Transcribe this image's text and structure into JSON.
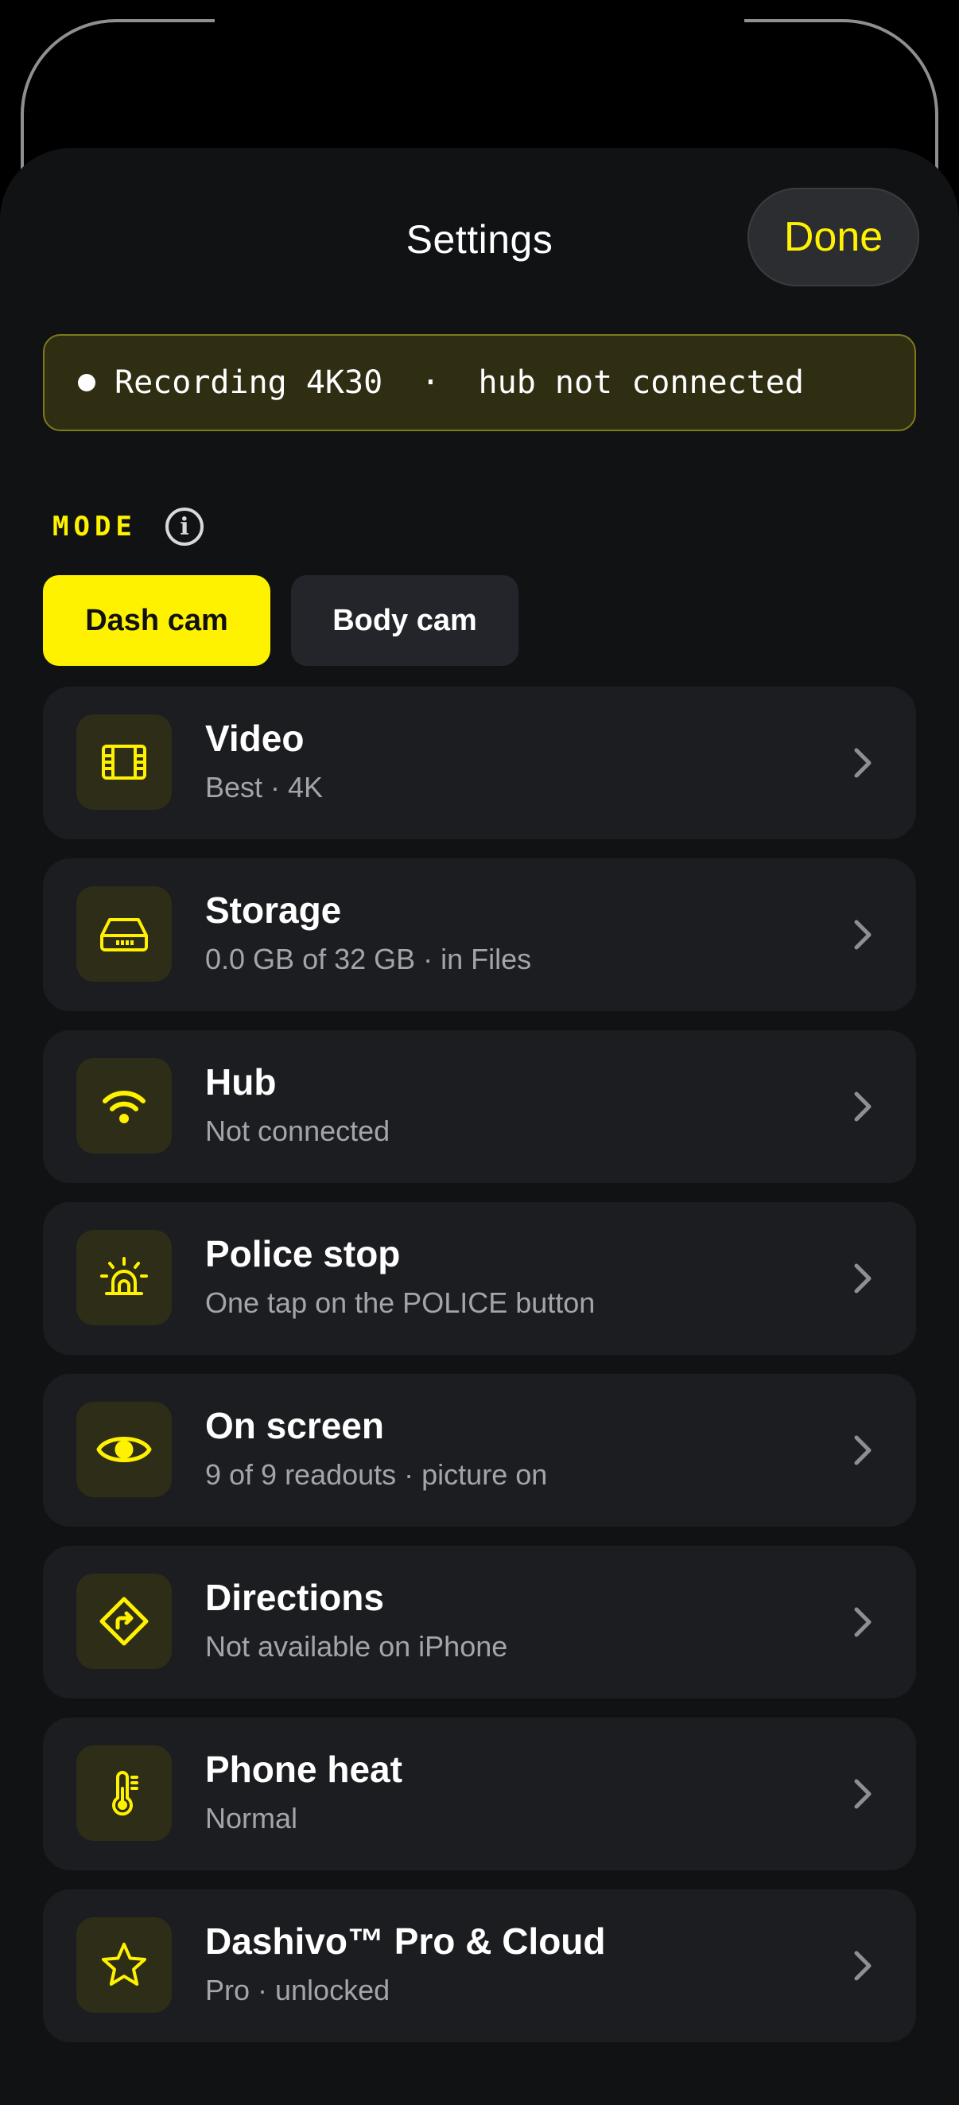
{
  "header": {
    "title": "Settings",
    "done_label": "Done"
  },
  "status": {
    "text": "Recording 4K30  ·  hub not connected"
  },
  "mode": {
    "label": "MODE",
    "info_glyph": "i",
    "tabs": [
      {
        "label": "Dash cam",
        "active": true
      },
      {
        "label": "Body cam",
        "active": false
      }
    ]
  },
  "settings": [
    {
      "title": "Video",
      "subtitle": "Best · 4K",
      "icon": "film-icon"
    },
    {
      "title": "Storage",
      "subtitle": "0.0 GB of 32 GB · in Files",
      "icon": "drive-icon"
    },
    {
      "title": "Hub",
      "subtitle": "Not connected",
      "icon": "wifi-icon"
    },
    {
      "title": "Police stop",
      "subtitle": "One tap on the POLICE button",
      "icon": "siren-icon"
    },
    {
      "title": "On screen",
      "subtitle": "9 of 9 readouts · picture on",
      "icon": "eye-icon"
    },
    {
      "title": "Directions",
      "subtitle": "Not available on iPhone",
      "icon": "directions-icon"
    },
    {
      "title": "Phone heat",
      "subtitle": "Normal",
      "icon": "thermometer-icon"
    },
    {
      "title": "Dashivo™ Pro & Cloud",
      "subtitle": "Pro · unlocked",
      "icon": "star-icon"
    }
  ],
  "colors": {
    "accent": "#fff200",
    "background": "#111214",
    "row": "#1c1d20",
    "icon_tile": "#2e2d18"
  }
}
